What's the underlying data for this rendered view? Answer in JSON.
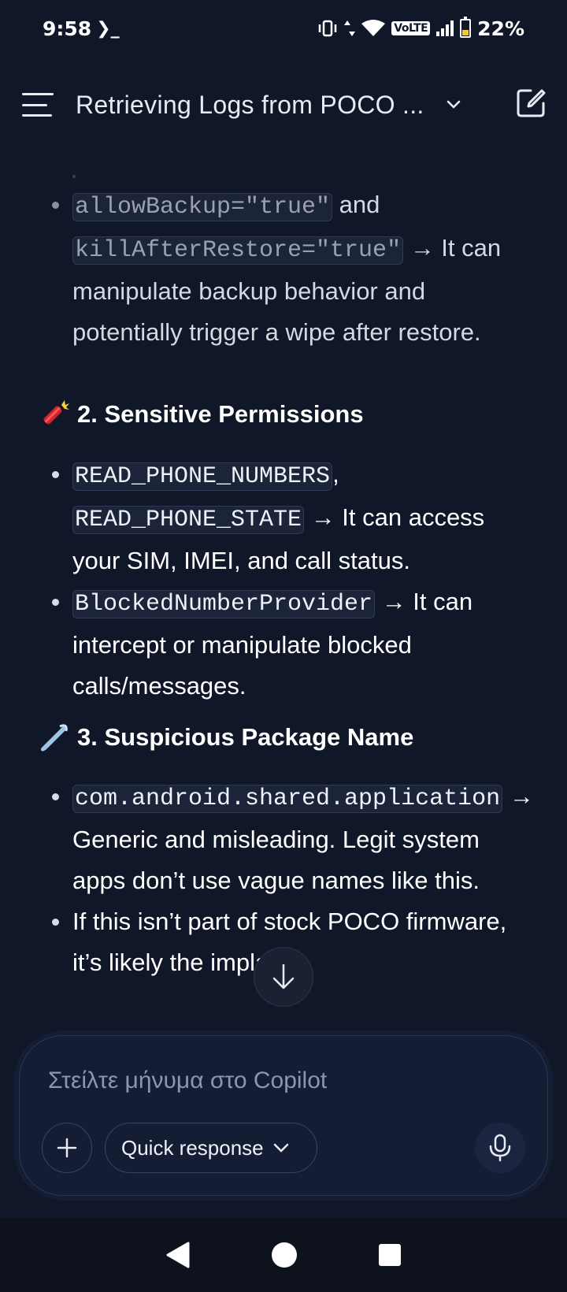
{
  "status": {
    "time": "9:58",
    "terminal_glyph": "❯_",
    "volte": "VoLTE",
    "battery": "22%"
  },
  "header": {
    "title": "Retrieving Logs from POCO ..."
  },
  "content": {
    "intro_bullet": {
      "code1": "allowBackup=\"true\"",
      "mid": " and ",
      "code2": "killAfterRestore=\"true\"",
      "tail": " → It can manipulate backup behavior and potentially trigger a wipe after restore."
    },
    "section2": {
      "emoji": "firecracker-icon",
      "title": "2. Sensitive Permissions",
      "bullets": [
        {
          "code1": "READ_PHONE_NUMBERS",
          "sep": ",",
          "code2": "READ_PHONE_STATE",
          "tail": " → It can access your SIM, IMEI, and call status."
        },
        {
          "code1": "BlockedNumberProvider",
          "tail": " → It can intercept or manipulate blocked calls/messages."
        }
      ]
    },
    "section3": {
      "emoji": "safety-pin-icon",
      "title": "3. Suspicious Package Name",
      "bullets": [
        {
          "code1": "com.android.shared.application",
          "tail": " → Generic and misleading. Legit system apps don’t use vague names like this."
        },
        {
          "text": "If this isn’t part of stock POCO firmware, it’s likely the implant."
        }
      ]
    }
  },
  "composer": {
    "placeholder": "Στείλτε μήνυμα στο Copilot",
    "quick_label": "Quick response"
  },
  "colors": {
    "background": "#101728",
    "code_bg": "#1b2438",
    "composer_bg": "#141d33"
  }
}
